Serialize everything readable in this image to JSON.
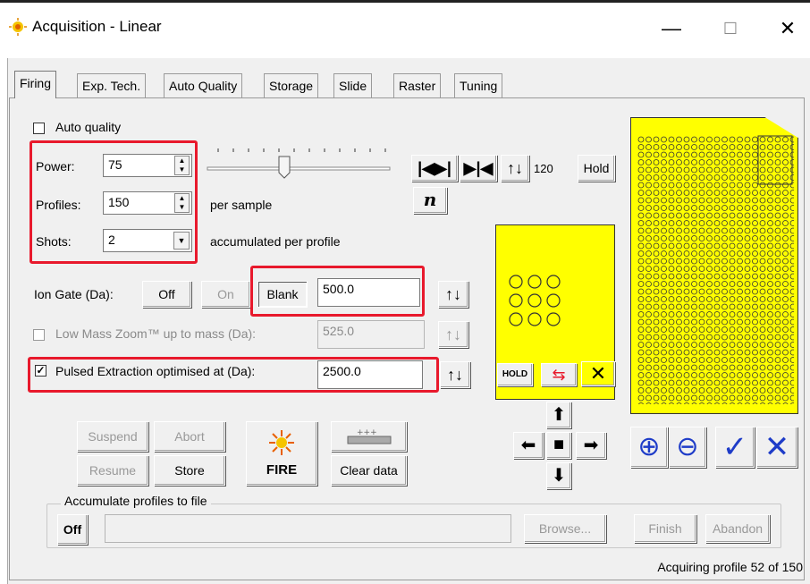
{
  "window": {
    "title": "Acquisition - Linear",
    "minimize": "—",
    "maximize": "☐",
    "close": "✕"
  },
  "tabs": [
    {
      "label": "Firing",
      "active": true
    },
    {
      "label": "Exp. Tech."
    },
    {
      "label": "Auto Quality"
    },
    {
      "label": "Storage"
    },
    {
      "label": "Slide"
    },
    {
      "label": "Raster"
    },
    {
      "label": "Tuning"
    }
  ],
  "firing": {
    "auto_quality_label": "Auto quality",
    "power_label": "Power:",
    "power_value": "75",
    "profiles_label": "Profiles:",
    "profiles_value": "150",
    "profiles_suffix": "per sample",
    "shots_label": "Shots:",
    "shots_value": "2",
    "shots_suffix": "accumulated per profile",
    "slider_value_fraction": 0.43,
    "counter_value": "120",
    "hold_label": "Hold",
    "n_label": "n",
    "ion_gate_label": "Ion Gate (Da):",
    "off_label": "Off",
    "on_label": "On",
    "blank_label": "Blank",
    "ion_gate_value": "500.0",
    "low_mass_label": "Low Mass Zoom™ up to mass (Da):",
    "low_mass_value": "525.0",
    "pulsed_label": "Pulsed Extraction optimised at (Da):",
    "pulsed_value": "2500.0",
    "pulsed_checked": true,
    "hold_icon_text": "HOLD",
    "suspend_label": "Suspend",
    "abort_label": "Abort",
    "resume_label": "Resume",
    "store_label": "Store",
    "fire_label": "FIRE",
    "clear_label": "Clear data",
    "accumulate_label": "Accumulate profiles to file",
    "acc_off_label": "Off",
    "browse_label": "Browse...",
    "finish_label": "Finish",
    "abandon_label": "Abandon",
    "status_text": "Acquiring profile 52 of 150"
  },
  "colors": {
    "highlight": "#e8192c",
    "yellow": "#ffff00",
    "blue": "#1e3cc8"
  }
}
